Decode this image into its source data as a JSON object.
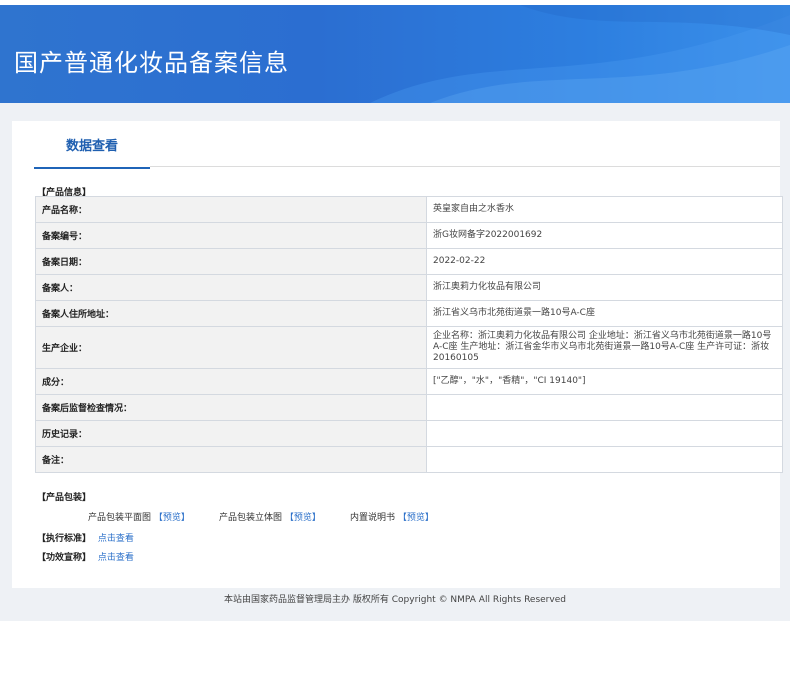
{
  "header": {
    "title": "国产普通化妆品备案信息"
  },
  "tab": {
    "label": "数据查看"
  },
  "product_info": {
    "section_label": "【产品信息】",
    "rows": [
      {
        "key": "产品名称：",
        "value": "英皇家自由之水香水"
      },
      {
        "key": "备案编号：",
        "value": "浙G妆网备字2022001692"
      },
      {
        "key": "备案日期：",
        "value": "2022-02-22"
      },
      {
        "key": "备案人：",
        "value": "浙江奥莉力化妆品有限公司"
      },
      {
        "key": "备案人住所地址：",
        "value": "浙江省义乌市北苑街道景一路10号A-C座"
      },
      {
        "key": "生产企业：",
        "value": "企业名称：浙江奥莉力化妆品有限公司 企业地址：浙江省义乌市北苑街道景一路10号A-C座 生产地址：浙江省金华市义乌市北苑街道景一路10号A-C座 生产许可证：浙妆20160105"
      },
      {
        "key": "成分：",
        "value": "[\"乙醇\"，\"水\"，\"香精\"，\"CI 19140\"]"
      },
      {
        "key": "备案后监督检查情况：",
        "value": ""
      },
      {
        "key": "历史记录：",
        "value": ""
      },
      {
        "key": "备注：",
        "value": ""
      }
    ]
  },
  "packaging": {
    "section_label": "【产品包装】",
    "items": [
      {
        "label": "产品包装平面图",
        "link": "预览"
      },
      {
        "label": "产品包装立体图",
        "link": "预览"
      },
      {
        "label": "内置说明书",
        "link": "预览"
      }
    ]
  },
  "standard": {
    "label": "【执行标准】",
    "link": "点击查看"
  },
  "efficacy": {
    "label": "【功效宣称】",
    "link": "点击查看"
  },
  "footer": {
    "text": "本站由国家药品监督管理局主办 版权所有 Copyright © NMPA All Rights Reserved"
  },
  "colors": {
    "header_blue": "#2f74cf",
    "link_blue": "#2a6fc9",
    "tab_blue": "#1f5fb0"
  }
}
